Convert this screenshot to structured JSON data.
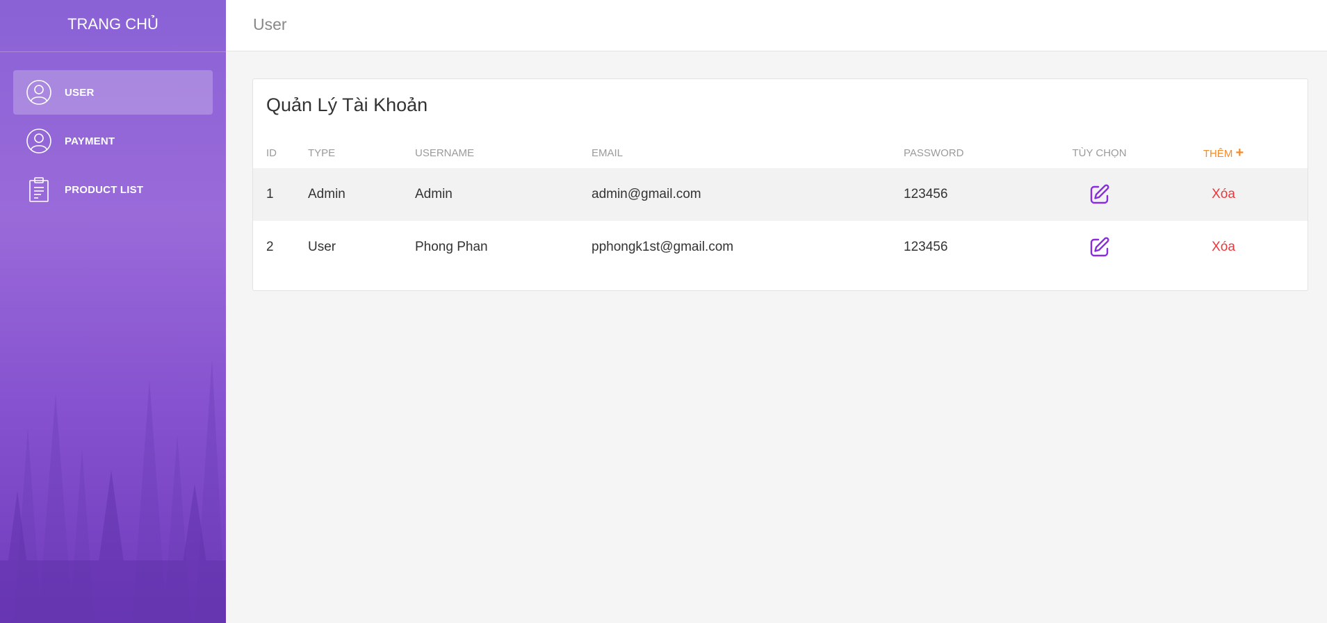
{
  "sidebar": {
    "brand": "TRANG CHỦ",
    "items": [
      {
        "label": "USER",
        "icon": "user-icon",
        "active": true
      },
      {
        "label": "PAYMENT",
        "icon": "user-icon",
        "active": false
      },
      {
        "label": "PRODUCT LIST",
        "icon": "clipboard-icon",
        "active": false
      }
    ]
  },
  "header": {
    "title": "User"
  },
  "main": {
    "card_title": "Quản Lý Tài Khoản",
    "columns": {
      "id": "ID",
      "type": "TYPE",
      "username": "USERNAME",
      "email": "EMAIL",
      "password": "PASSWORD",
      "options": "TÙY CHỌN",
      "add": "THÊM",
      "add_icon": "+"
    },
    "rows": [
      {
        "id": "1",
        "type": "Admin",
        "username": "Admin",
        "email": "admin@gmail.com",
        "password": "123456",
        "delete_label": "Xóa"
      },
      {
        "id": "2",
        "type": "User",
        "username": "Phong Phan",
        "email": "pphongk1st@gmail.com",
        "password": "123456",
        "delete_label": "Xóa"
      }
    ]
  },
  "colors": {
    "accent": "#8a2be2",
    "add": "#f08c2e",
    "delete": "#e8383d",
    "sidebar_top": "#8a62d6",
    "sidebar_bottom": "#6f3bbb"
  }
}
